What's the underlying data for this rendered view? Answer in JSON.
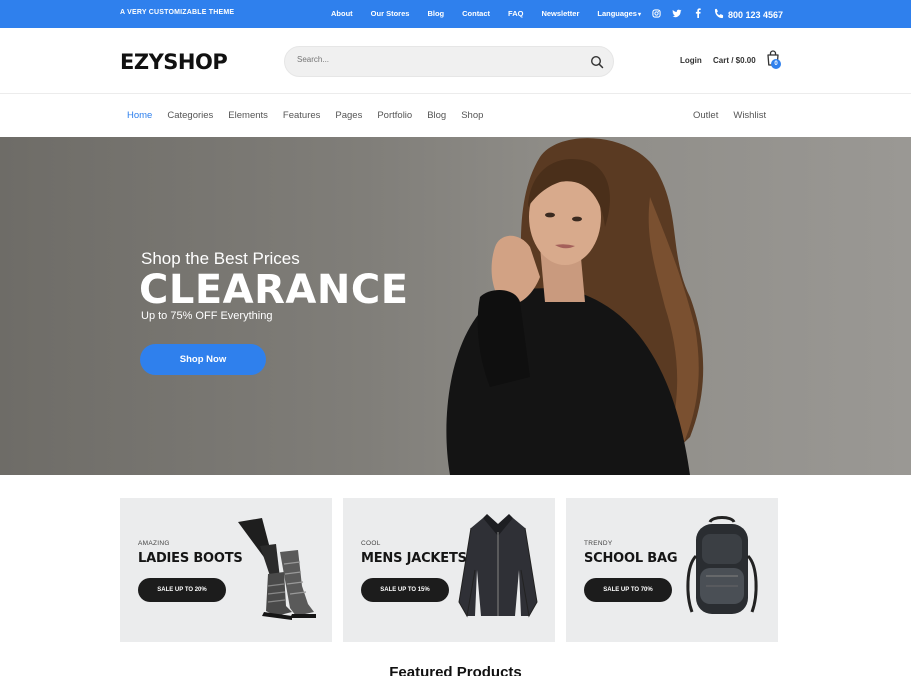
{
  "topbar": {
    "tagline": "A VERY CUSTOMIZABLE THEME",
    "links": [
      "About",
      "Our Stores",
      "Blog",
      "Contact",
      "FAQ",
      "Newsletter",
      "Languages"
    ],
    "phone": "800 123 4567"
  },
  "header": {
    "logo": "EZYSHOP",
    "search_placeholder": "Search...",
    "login": "Login",
    "cart": "Cart / $0.00",
    "cart_count": "0"
  },
  "nav": {
    "main": [
      "Home",
      "Categories",
      "Elements",
      "Features",
      "Pages",
      "Portfolio",
      "Blog",
      "Shop"
    ],
    "right": [
      "Outlet",
      "Wishlist"
    ]
  },
  "hero": {
    "pre": "Shop the Best Prices",
    "title": "CLEARANCE",
    "sub": "Up to 75% OFF Everything",
    "button": "Shop Now"
  },
  "cards": [
    {
      "small": "AMAZING",
      "big": "LADIES BOOTS",
      "pill": "SALE UP TO 20%"
    },
    {
      "small": "COOL",
      "big": "MENS JACKETS",
      "pill": "SALE UP TO 15%"
    },
    {
      "small": "TRENDY",
      "big": "SCHOOL BAG",
      "pill": "SALE UP TO 70%"
    }
  ],
  "featured_title": "Featured Products",
  "colors": {
    "accent": "#2f80ed",
    "dark_pill": "#1c1c1c",
    "card_bg": "#ebeced"
  }
}
